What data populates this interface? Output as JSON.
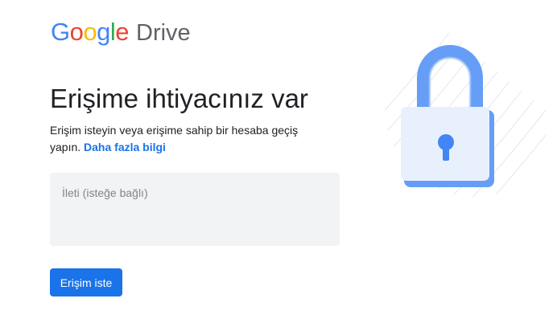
{
  "header": {
    "logo_letters": [
      {
        "char": "G",
        "color": "#4285F4"
      },
      {
        "char": "o",
        "color": "#EA4335"
      },
      {
        "char": "o",
        "color": "#FBBC05"
      },
      {
        "char": "g",
        "color": "#4285F4"
      },
      {
        "char": "l",
        "color": "#34A853"
      },
      {
        "char": "e",
        "color": "#EA4335"
      }
    ],
    "product": "Drive"
  },
  "main": {
    "title": "Erişime ihtiyacınız var",
    "description": "Erişim isteyin veya erişime sahip bir hesaba geçiş yapın.",
    "learn_more_link": "Daha fazla bilgi",
    "message_placeholder": "İleti (isteğe bağlı)",
    "message_value": "",
    "request_button": "Erişim iste"
  },
  "illustration": {
    "icon": "padlock-icon",
    "accent_color": "#669df6",
    "body_color": "#e8f0fe"
  }
}
